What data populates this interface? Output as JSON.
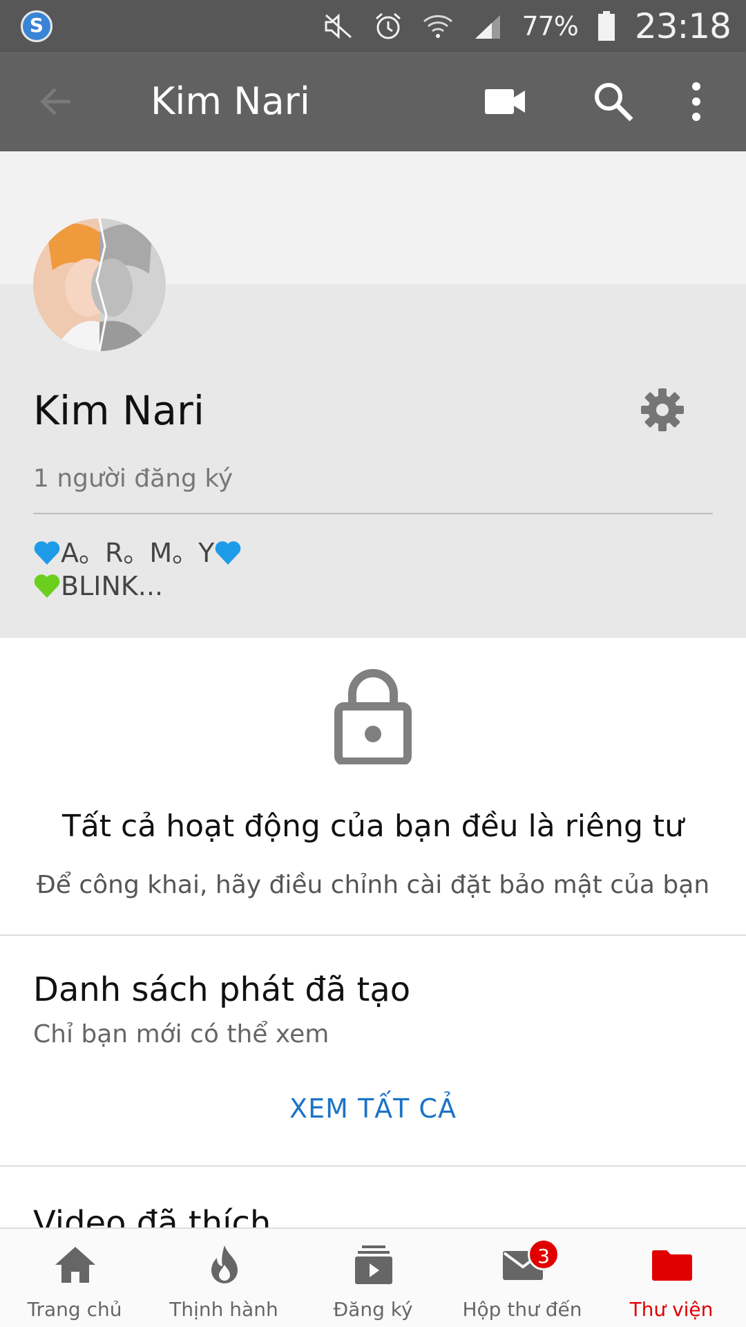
{
  "status_bar": {
    "app_icon": "S",
    "battery": "77%",
    "time": "23:18",
    "icons": [
      "mute-icon",
      "alarm-icon",
      "wifi-icon",
      "signal-icon",
      "battery-icon"
    ]
  },
  "app_bar": {
    "title": "Kim Nari",
    "icons": [
      "back-arrow-icon",
      "video-camera-icon",
      "search-icon",
      "more-vertical-icon"
    ]
  },
  "profile": {
    "name": "Kim Nari",
    "subscribers": "1 người đăng ký",
    "bio_line1": "A。R。M。Y",
    "bio_line2": "BLINK...",
    "heart_colors": {
      "blue": "#1e9be8",
      "green": "#6ccf1e"
    }
  },
  "privacy": {
    "title": "Tất cả hoạt động của bạn đều là riêng tư",
    "subtitle": "Để công khai, hãy điều chỉnh cài đặt bảo mật của bạn"
  },
  "playlists": {
    "title": "Danh sách phát đã tạo",
    "subtitle": "Chỉ bạn mới có thể xem",
    "see_all": "XEM TẤT CẢ"
  },
  "liked": {
    "title": "Video đã thích"
  },
  "bottom_nav": {
    "items": [
      {
        "label": "Trang chủ",
        "icon": "home-icon"
      },
      {
        "label": "Thịnh hành",
        "icon": "fire-icon"
      },
      {
        "label": "Đăng ký",
        "icon": "subscriptions-icon"
      },
      {
        "label": "Hộp thư đến",
        "icon": "inbox-icon",
        "badge": "3"
      },
      {
        "label": "Thư viện",
        "icon": "library-folder-icon",
        "active": true
      }
    ]
  },
  "colors": {
    "accent": "#e00000",
    "link": "#1a73c8",
    "app_bar": "#616161",
    "status_bar": "#575757"
  }
}
